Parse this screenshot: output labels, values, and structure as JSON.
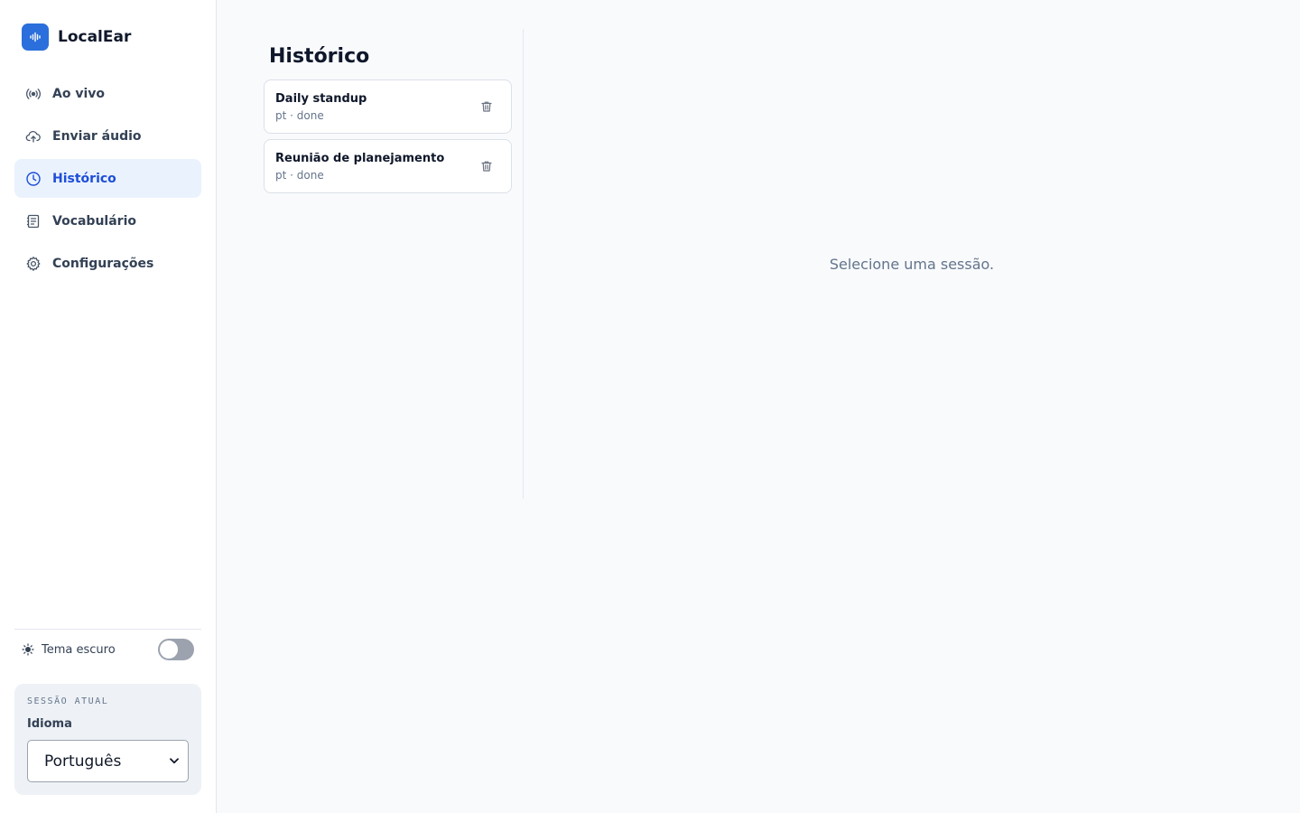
{
  "app": {
    "name": "LocalEar",
    "accent": "#2a6fdb"
  },
  "sidebar": {
    "items": [
      {
        "label": "Ao vivo",
        "icon": "broadcast-icon",
        "active": false
      },
      {
        "label": "Enviar áudio",
        "icon": "cloud-upload-icon",
        "active": false
      },
      {
        "label": "Histórico",
        "icon": "clock-icon",
        "active": true
      },
      {
        "label": "Vocabulário",
        "icon": "book-icon",
        "active": false
      },
      {
        "label": "Configurações",
        "icon": "gear-icon",
        "active": false
      }
    ],
    "theme": {
      "label": "Tema escuro",
      "enabled": false
    },
    "session": {
      "title": "SESSÃO ATUAL",
      "language_label": "Idioma",
      "language_value": "Português"
    }
  },
  "history": {
    "title": "Histórico",
    "sessions": [
      {
        "title": "Daily standup",
        "meta": "pt · done"
      },
      {
        "title": "Reunião de planejamento",
        "meta": "pt · done"
      }
    ],
    "empty_message": "Selecione uma sessão."
  }
}
